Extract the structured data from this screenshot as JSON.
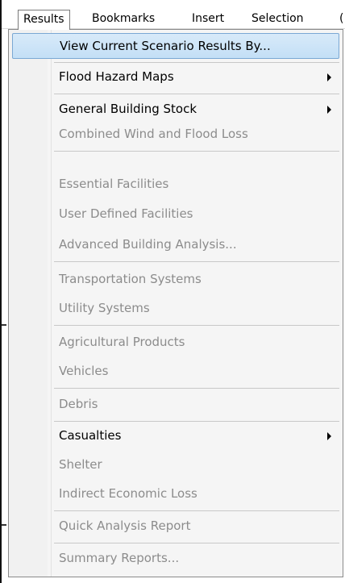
{
  "menubar": {
    "items": [
      "Results",
      "Bookmarks",
      "Insert",
      "Selection",
      "("
    ]
  },
  "dropdown": {
    "items": [
      {
        "label": "View Current Scenario Results By...",
        "enabled": true,
        "highlighted": true,
        "submenu": false
      },
      {
        "label": "Flood Hazard Maps",
        "enabled": true,
        "submenu": true
      },
      {
        "label": "General Building Stock",
        "enabled": true,
        "submenu": true
      },
      {
        "label": "Combined Wind and Flood Loss",
        "enabled": false,
        "submenu": false
      },
      {
        "label": "Essential Facilities",
        "enabled": false,
        "submenu": false
      },
      {
        "label": "User Defined Facilities",
        "enabled": false,
        "submenu": false
      },
      {
        "label": "Advanced Building Analysis...",
        "enabled": false,
        "submenu": false
      },
      {
        "label": "Transportation Systems",
        "enabled": false,
        "submenu": false
      },
      {
        "label": "Utility Systems",
        "enabled": false,
        "submenu": false
      },
      {
        "label": "Agricultural Products",
        "enabled": false,
        "submenu": false
      },
      {
        "label": "Vehicles",
        "enabled": false,
        "submenu": false
      },
      {
        "label": "Debris",
        "enabled": false,
        "submenu": false
      },
      {
        "label": "Casualties",
        "enabled": true,
        "submenu": true
      },
      {
        "label": "Shelter",
        "enabled": false,
        "submenu": false
      },
      {
        "label": "Indirect Economic Loss",
        "enabled": false,
        "submenu": false
      },
      {
        "label": "Quick Analysis Report",
        "enabled": false,
        "submenu": false
      },
      {
        "label": "Summary Reports...",
        "enabled": false,
        "submenu": false
      }
    ]
  },
  "colors": {
    "highlight": "#c3dff6",
    "disabled_text": "#8c8c8c",
    "menu_background": "#f5f5f5"
  },
  "icons": {
    "submenu": "submenu-arrow-icon"
  }
}
